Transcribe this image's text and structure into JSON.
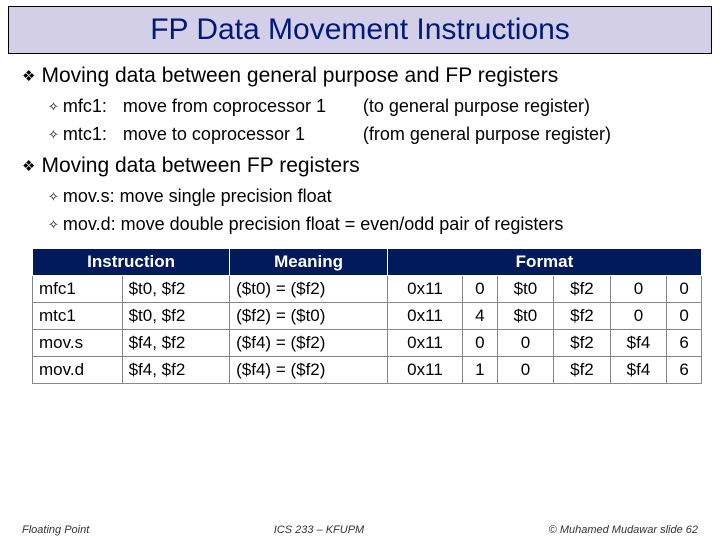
{
  "title": "FP Data Movement Instructions",
  "section1": {
    "heading": "Moving data between general purpose and FP registers",
    "items": [
      {
        "name": "mfc1:",
        "desc": "move from coprocessor 1",
        "note": "(to general purpose register)"
      },
      {
        "name": "mtc1:",
        "desc": "move to coprocessor 1",
        "note": "(from general purpose register)"
      }
    ]
  },
  "section2": {
    "heading": "Moving data between FP registers",
    "items": [
      {
        "text": "mov.s: move single precision float"
      },
      {
        "text": "mov.d: move double precision float = even/odd pair of registers"
      }
    ]
  },
  "table_headers": {
    "h1": "Instruction",
    "h2": "Meaning",
    "h3": "Format"
  },
  "chart_data": {
    "type": "table",
    "columns": [
      "mnem",
      "args",
      "meaning",
      "f0",
      "f1",
      "f2",
      "f3",
      "f4",
      "f5"
    ],
    "rows": [
      {
        "mnem": "mfc1",
        "args": "$t0, $f2",
        "meaning": "($t0) = ($f2)",
        "f0": "0x11",
        "f1": "0",
        "f2": "$t0",
        "f3": "$f2",
        "f4": "0",
        "f5": "0"
      },
      {
        "mnem": "mtc1",
        "args": "$t0, $f2",
        "meaning": "($f2) = ($t0)",
        "f0": "0x11",
        "f1": "4",
        "f2": "$t0",
        "f3": "$f2",
        "f4": "0",
        "f5": "0"
      },
      {
        "mnem": "mov.s",
        "args": "$f4, $f2",
        "meaning": "($f4) = ($f2)",
        "f0": "0x11",
        "f1": "0",
        "f2": "0",
        "f3": "$f2",
        "f4": "$f4",
        "f5": "6"
      },
      {
        "mnem": "mov.d",
        "args": "$f4, $f2",
        "meaning": "($f4) = ($f2)",
        "f0": "0x11",
        "f1": "1",
        "f2": "0",
        "f3": "$f2",
        "f4": "$f4",
        "f5": "6"
      }
    ]
  },
  "footer": {
    "left": "Floating Point",
    "mid": "ICS 233 – KFUPM",
    "right": "© Muhamed Mudawar  slide 62"
  }
}
